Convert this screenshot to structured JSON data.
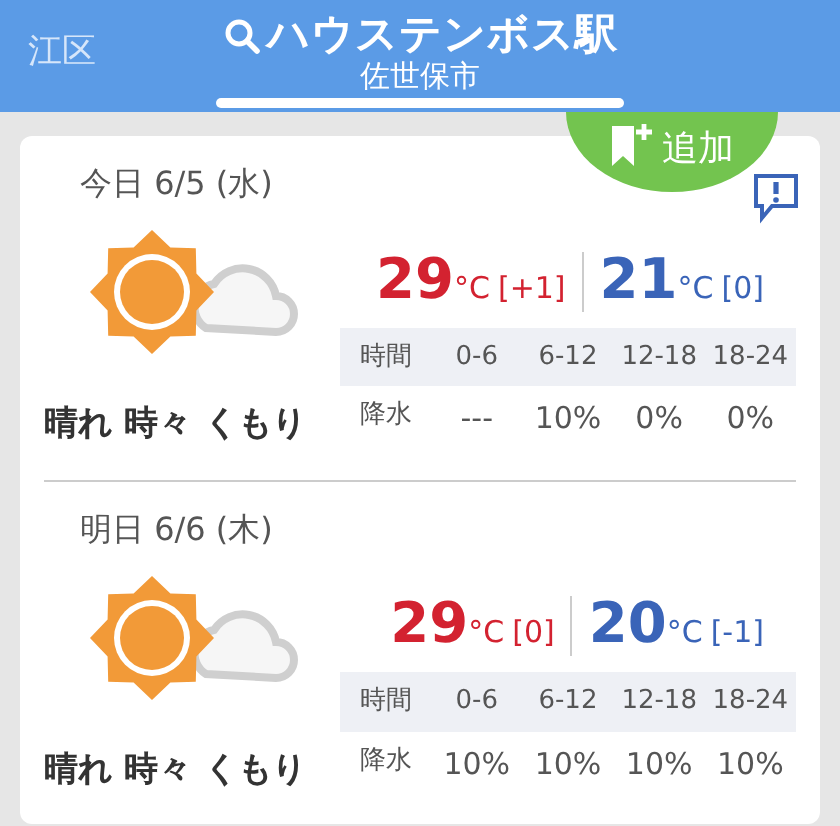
{
  "header": {
    "side_text": "江区",
    "title": "ハウステンボス駅",
    "subtitle": "佐世保市"
  },
  "add_button": {
    "label": "追加"
  },
  "days": [
    {
      "date": "今日 6/5 (水)",
      "weather": "晴れ 時々 くもり",
      "high": {
        "value": "29",
        "unit": "°C",
        "diff": "[+1]"
      },
      "low": {
        "value": "21",
        "unit": "°C",
        "diff": "[0]"
      },
      "columns": [
        "時間",
        "0-6",
        "6-12",
        "12-18",
        "18-24"
      ],
      "rain": [
        "降水",
        "---",
        "10%",
        "0%",
        "0%"
      ]
    },
    {
      "date": "明日 6/6 (木)",
      "weather": "晴れ 時々 くもり",
      "high": {
        "value": "29",
        "unit": "°C",
        "diff": "[0]"
      },
      "low": {
        "value": "20",
        "unit": "°C",
        "diff": "[-1]"
      },
      "columns": [
        "時間",
        "0-6",
        "6-12",
        "12-18",
        "18-24"
      ],
      "rain": [
        "降水",
        "10%",
        "10%",
        "10%",
        "10%"
      ]
    }
  ]
}
